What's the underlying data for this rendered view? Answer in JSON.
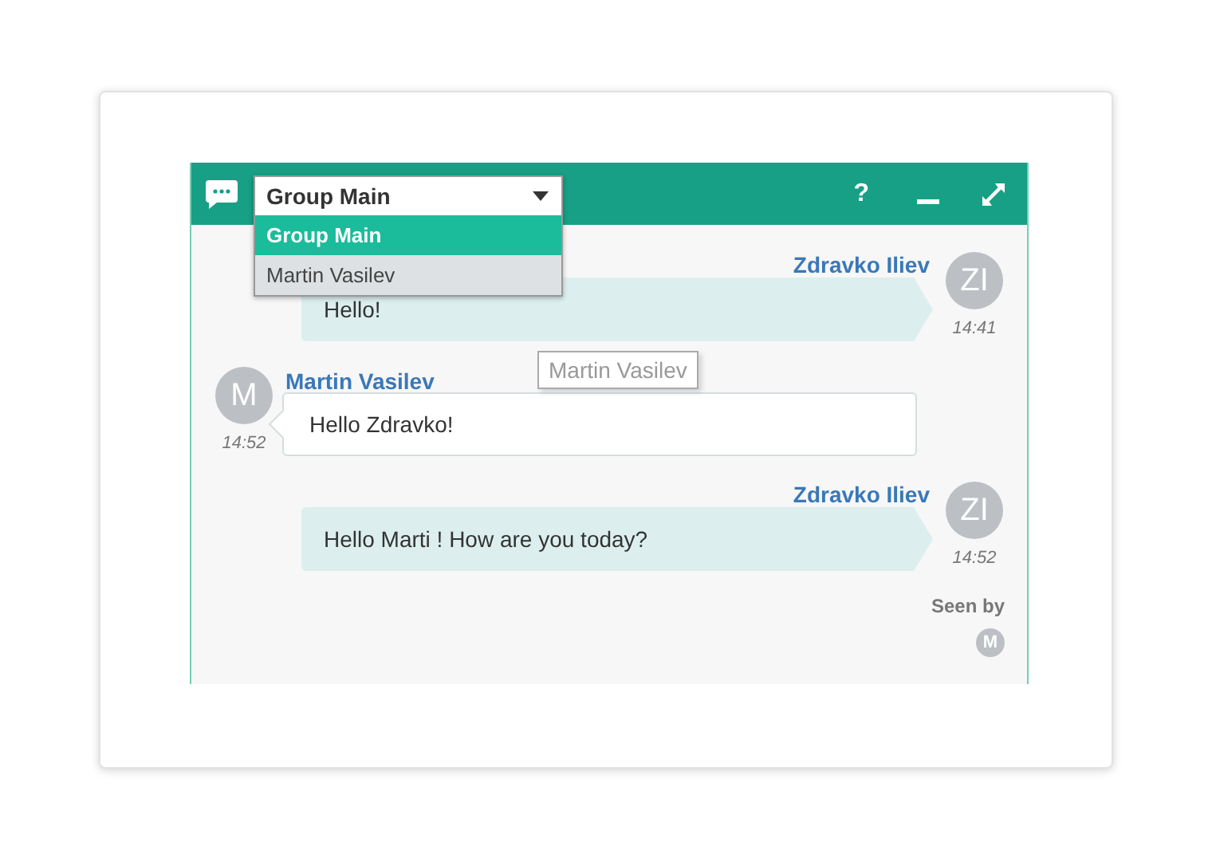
{
  "header": {
    "conversation": "Group Main",
    "help": "?"
  },
  "dropdown": {
    "options": [
      {
        "label": "Group Main",
        "selected": true
      },
      {
        "label": "Martin Vasilev",
        "selected": false
      }
    ]
  },
  "tooltip": "Martin Vasilev",
  "messages": [
    {
      "kind": "outgoing",
      "sender": "Zdravko Iliev",
      "initials": "ZI",
      "text": "Hello!",
      "time": "14:41"
    },
    {
      "kind": "incoming",
      "sender": "Martin Vasilev",
      "initials": "M",
      "text": "Hello Zdravko!",
      "time": "14:52"
    },
    {
      "kind": "outgoing",
      "sender": "Zdravko Iliev",
      "initials": "ZI",
      "text": "Hello Marti ! How are you today?",
      "time": "14:52"
    }
  ],
  "seen_by": {
    "label": "Seen by",
    "avatars": [
      "M"
    ]
  }
}
